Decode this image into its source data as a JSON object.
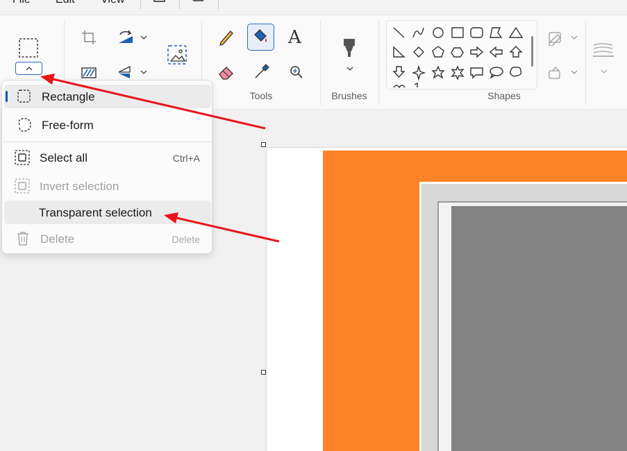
{
  "menubar": {
    "file": "File",
    "edit": "Edit",
    "view": "View"
  },
  "ribbon": {
    "groups": {
      "tools": "Tools",
      "brushes": "Brushes",
      "shapes": "Shapes"
    },
    "text_tool_glyph": "A"
  },
  "selection_menu": {
    "items": [
      {
        "label": "Rectangle",
        "icon": "rectangle-select-icon",
        "selected": true
      },
      {
        "label": "Free-form",
        "icon": "freeform-select-icon",
        "selected": false
      },
      {
        "label": "Select all",
        "shortcut": "Ctrl+A",
        "icon": "select-all-icon",
        "enabled": true
      },
      {
        "label": "Invert selection",
        "icon": "invert-selection-icon",
        "enabled": false
      },
      {
        "label": "Transparent selection",
        "enabled": true,
        "hovered": true
      },
      {
        "label": "Delete",
        "shortcut": "Delete",
        "icon": "trash-icon",
        "enabled": false
      }
    ]
  },
  "colors": {
    "accent": "#0b5cad",
    "annotation_arrow": "#e8141b",
    "image_orange": "#fe8227",
    "image_gray": "#838383"
  }
}
